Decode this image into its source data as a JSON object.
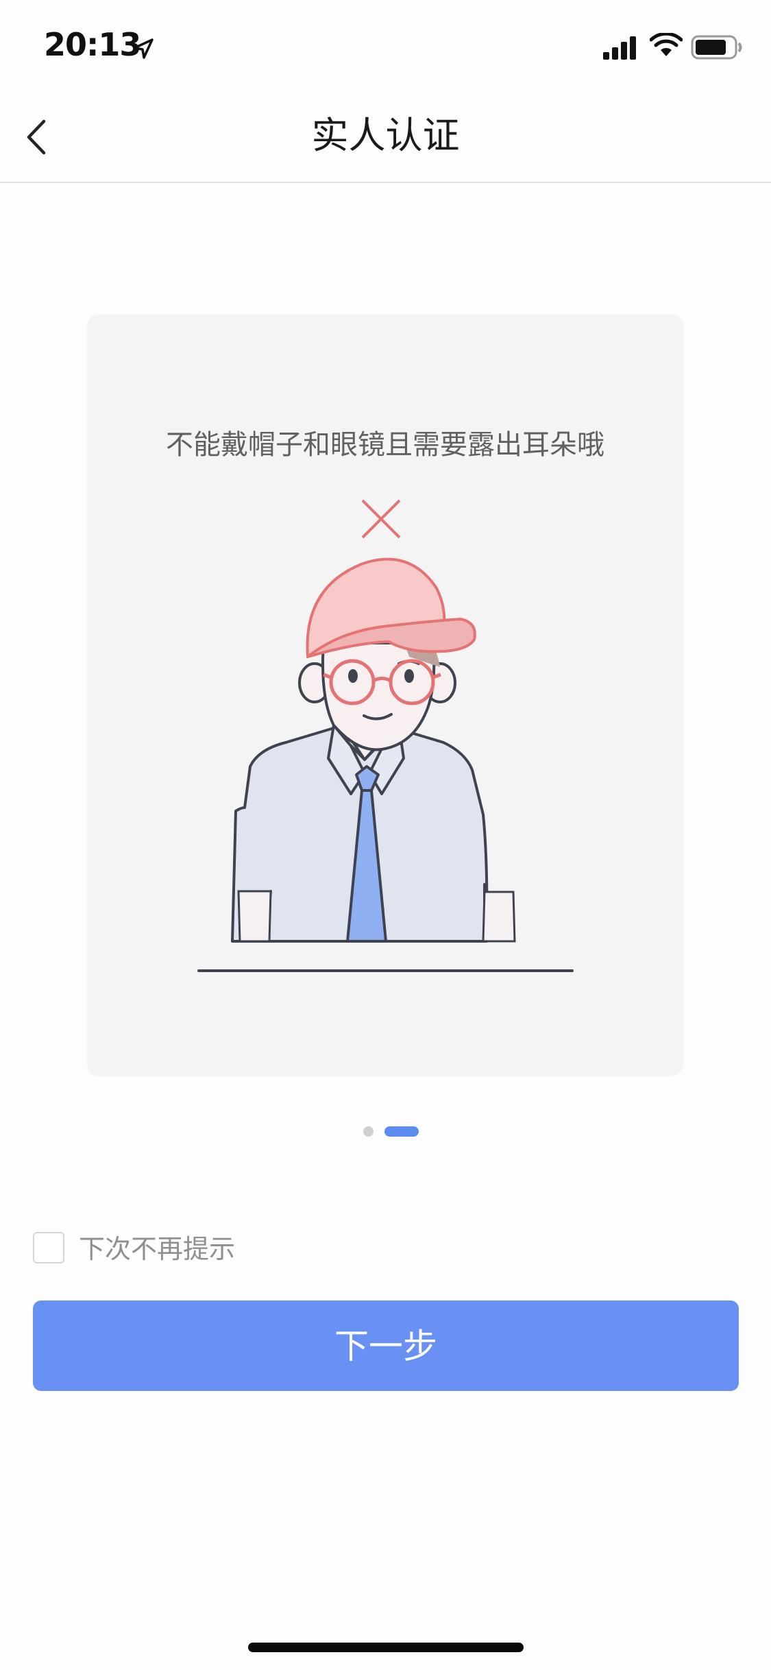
{
  "status_bar": {
    "time": "20:13",
    "icons": [
      "location-arrow-icon",
      "signal-icon",
      "wifi-icon",
      "battery-icon"
    ]
  },
  "nav": {
    "title": "实人认证",
    "back_icon": "chevron-left-icon"
  },
  "guide": {
    "caption": "不能戴帽子和眼镜且需要露出耳朵哦",
    "status_icon": "cross-icon",
    "illustration": "person-with-cap-and-glasses",
    "page_count": 2,
    "current_page": 2
  },
  "options": {
    "dont_show_again_label": "下次不再提示",
    "dont_show_again_checked": false
  },
  "actions": {
    "next_label": "下一步"
  },
  "colors": {
    "primary": "#6991f4",
    "pager_active": "#5b8cf2",
    "cross": "#e57373",
    "card_bg": "#f4f4f4"
  }
}
